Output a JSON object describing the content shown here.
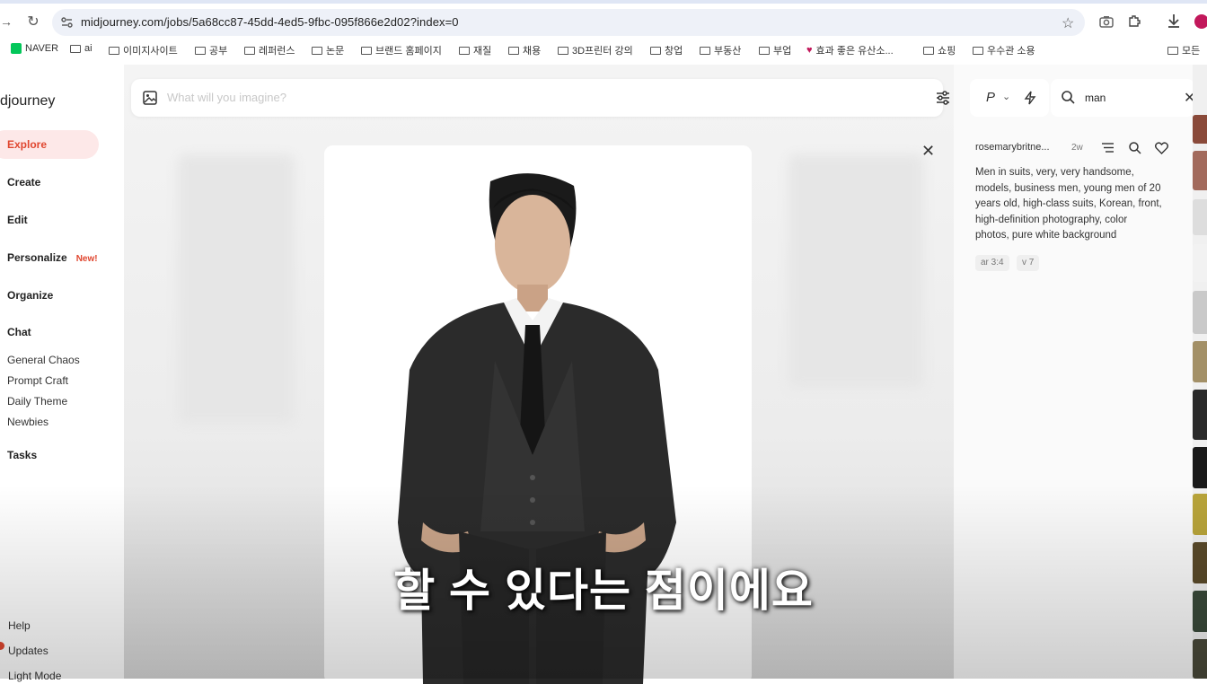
{
  "browser": {
    "url": "midjourney.com/jobs/5a68cc87-45dd-4ed5-9fbc-095f866e2d02?index=0",
    "bookmarks": [
      "NAVER",
      "ai",
      "이미지사이트",
      "공부",
      "레퍼런스",
      "논문",
      "브랜드 홈페이지",
      "재질",
      "채용",
      "3D프린터 강의",
      "창업",
      "부동산",
      "부업",
      "효과 좋은 유산소...",
      "쇼핑",
      "우수관 소용",
      "모든"
    ]
  },
  "sidebar": {
    "brand": "djourney",
    "nav": [
      {
        "label": "Explore",
        "active": true
      },
      {
        "label": "Create"
      },
      {
        "label": "Edit"
      },
      {
        "label": "Personalize",
        "badge": "New!"
      },
      {
        "label": "Organize"
      },
      {
        "label": "Chat"
      }
    ],
    "chat_rooms": [
      "General Chaos",
      "Prompt Craft",
      "Daily Theme",
      "Newbies"
    ],
    "tasks": "Tasks",
    "footer": [
      "Help",
      "Updates",
      "Light Mode"
    ]
  },
  "main": {
    "search_placeholder": "What will you imagine?"
  },
  "right_panel": {
    "mode_label": "P",
    "search_value": "man",
    "author": "rosemarybritne...",
    "age": "2w",
    "prompt": "Men in suits, very, very handsome, models, business men, young men of 20 years old, high-class suits, Korean, front, high-definition photography, color photos, pure white background",
    "tags": [
      "ar 3:4",
      "v 7"
    ]
  },
  "overlay": {
    "subtitle": "할 수 있다는 점이에요"
  },
  "colors": {
    "accent": "#e0462f",
    "active_bg": "#fde8e8"
  }
}
